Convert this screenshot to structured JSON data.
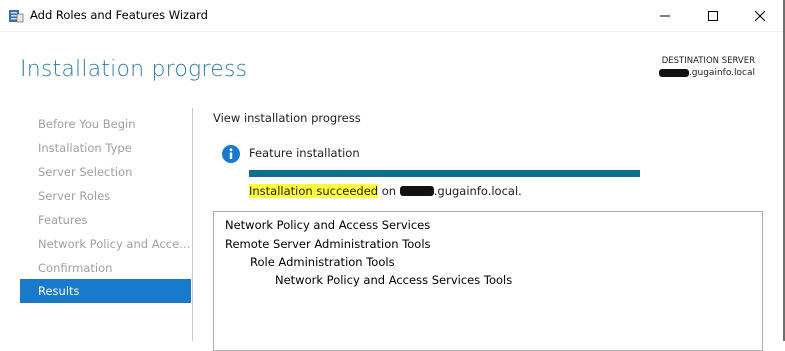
{
  "window": {
    "title": "Add Roles and Features Wizard",
    "controls": [
      "minimize",
      "maximize",
      "close"
    ]
  },
  "header": {
    "page_title": "Installation progress",
    "destination_label": "DESTINATION SERVER",
    "destination_value_suffix": ".gugainfo.local"
  },
  "sidebar": {
    "items": [
      {
        "label": "Before You Begin",
        "active": false
      },
      {
        "label": "Installation Type",
        "active": false
      },
      {
        "label": "Server Selection",
        "active": false
      },
      {
        "label": "Server Roles",
        "active": false
      },
      {
        "label": "Features",
        "active": false
      },
      {
        "label": "Network Policy and Access Services",
        "active": false
      },
      {
        "label": "Confirmation",
        "active": false
      },
      {
        "label": "Results",
        "active": true
      }
    ]
  },
  "main": {
    "heading": "View installation progress",
    "info_icon": "info-icon",
    "feature_label": "Feature installation",
    "progress": 1.0,
    "status_highlight": "Installation succeeded",
    "status_on": " on ",
    "status_server_suffix": ".gugainfo.local."
  },
  "results": {
    "items": [
      {
        "label": "Network Policy and Access Services",
        "level": 0
      },
      {
        "label": "Remote Server Administration Tools",
        "level": 0
      },
      {
        "label": "Role Administration Tools",
        "level": 1
      },
      {
        "label": "Network Policy and Access Services Tools",
        "level": 2
      }
    ]
  },
  "colors": {
    "accent": "#2b7dad",
    "selection": "#1979ca",
    "progress": "#0b6e8c",
    "highlight": "#ffff3c"
  }
}
